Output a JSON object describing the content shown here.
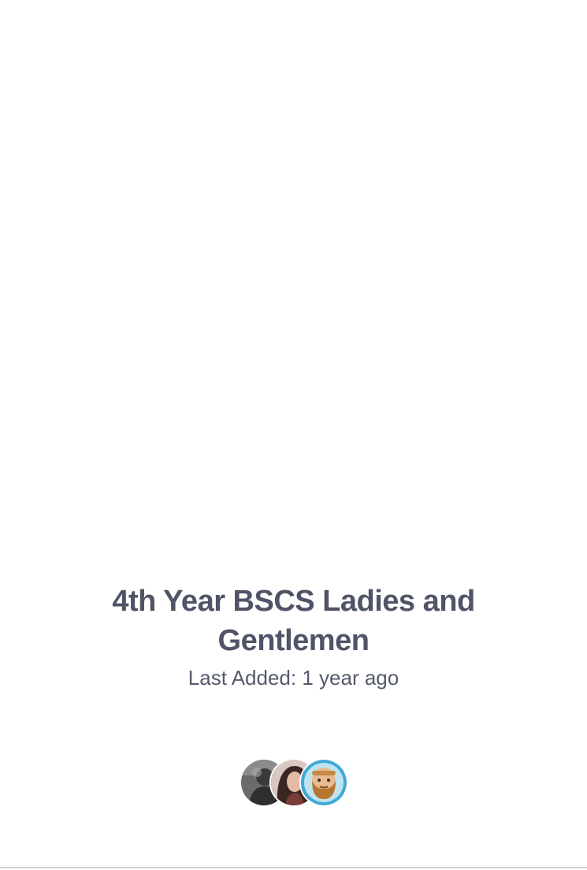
{
  "card": {
    "title_line_1": "4th Year BSCS Ladies and",
    "title_line_2": "Gentlemen",
    "last_added": "Last Added: 1 year ago"
  },
  "avatars": [
    {
      "icon": "person-avatar-icon"
    },
    {
      "icon": "person-avatar-icon"
    },
    {
      "icon": "bearded-man-avatar-icon"
    }
  ],
  "colors": {
    "title": "#4f5467",
    "meta": "#555b6c",
    "divider": "#cfd3d8",
    "avatar_ring_accent": "#3fa9d6"
  }
}
